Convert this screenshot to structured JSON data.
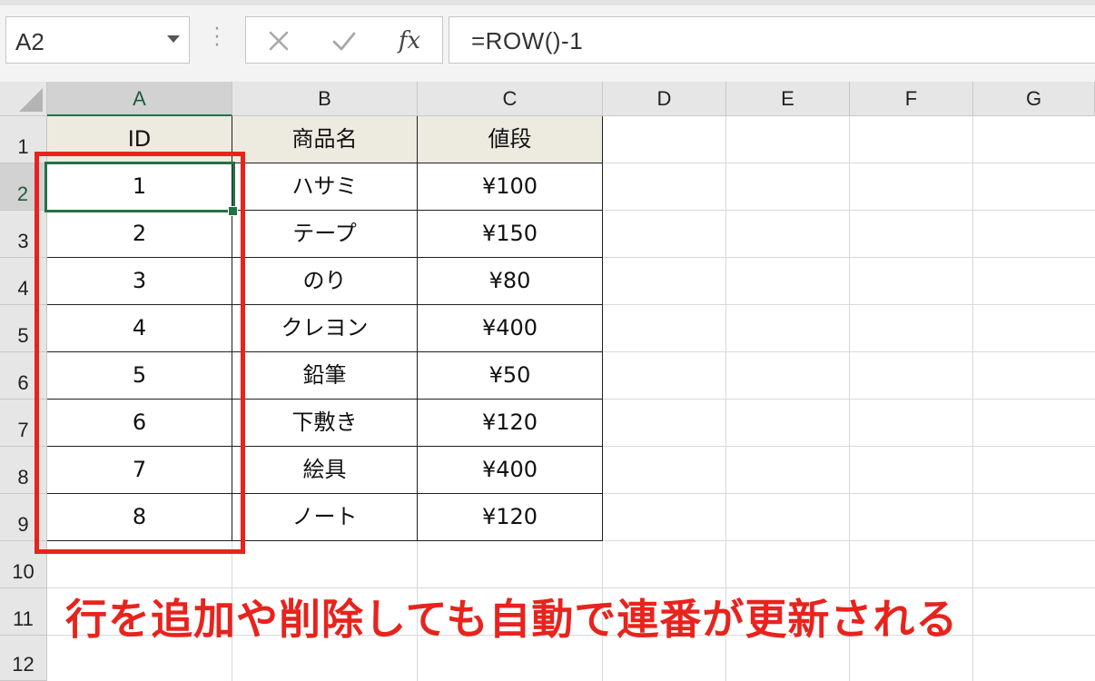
{
  "formula_bar": {
    "name_box": "A2",
    "formula": "=ROW()-1",
    "cancel_icon": "close-icon",
    "enter_icon": "checkmark-icon",
    "fx_label": "fx"
  },
  "columns": [
    "A",
    "B",
    "C",
    "D",
    "E",
    "F",
    "G"
  ],
  "selected_column": "A",
  "rows": [
    "1",
    "2",
    "3",
    "4",
    "5",
    "6",
    "7",
    "8",
    "9",
    "10",
    "11",
    "12"
  ],
  "selected_row": "2",
  "table": {
    "headers": [
      "ID",
      "商品名",
      "値段"
    ],
    "data": [
      [
        "1",
        "ハサミ",
        "¥100"
      ],
      [
        "2",
        "テープ",
        "¥150"
      ],
      [
        "3",
        "のり",
        "¥80"
      ],
      [
        "4",
        "クレヨン",
        "¥400"
      ],
      [
        "5",
        "鉛筆",
        "¥50"
      ],
      [
        "6",
        "下敷き",
        "¥120"
      ],
      [
        "7",
        "絵具",
        "¥400"
      ],
      [
        "8",
        "ノート",
        "¥120"
      ]
    ]
  },
  "annotation": "行を追加や削除しても自動で連番が更新される",
  "colors": {
    "accent": "#217346",
    "highlight": "#e8231d",
    "header_fill": "#edeae0"
  }
}
